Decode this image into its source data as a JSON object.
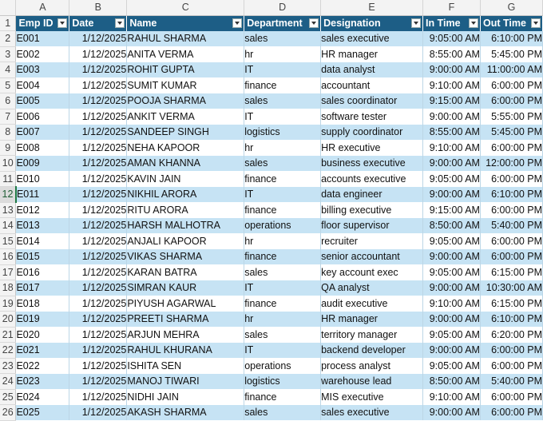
{
  "columns": [
    "A",
    "B",
    "C",
    "D",
    "E",
    "F",
    "G"
  ],
  "headers": [
    "Emp ID",
    "Date",
    "Name",
    "Department",
    "Designation",
    "In Time",
    "Out Time"
  ],
  "rows": [
    {
      "n": "2",
      "c": [
        "E001",
        "1/12/2025",
        "RAHUL SHARMA",
        "sales",
        "sales executive",
        "9:05:00 AM",
        "6:10:00 PM"
      ]
    },
    {
      "n": "3",
      "c": [
        "E002",
        "1/12/2025",
        "ANITA VERMA",
        "hr",
        "HR manager",
        "8:55:00 AM",
        "5:45:00 PM"
      ]
    },
    {
      "n": "4",
      "c": [
        "E003",
        "1/12/2025",
        "ROHIT GUPTA",
        "IT",
        "data analyst",
        "9:00:00 AM",
        "11:00:00 AM"
      ]
    },
    {
      "n": "5",
      "c": [
        "E004",
        "1/12/2025",
        "SUMIT KUMAR",
        "finance",
        "accountant",
        "9:10:00 AM",
        "6:00:00 PM"
      ]
    },
    {
      "n": "6",
      "c": [
        "E005",
        "1/12/2025",
        "POOJA SHARMA",
        "sales",
        "sales coordinator",
        "9:15:00 AM",
        "6:00:00 PM"
      ]
    },
    {
      "n": "7",
      "c": [
        "E006",
        "1/12/2025",
        "ANKIT VERMA",
        "IT",
        "software tester",
        "9:00:00 AM",
        "5:55:00 PM"
      ]
    },
    {
      "n": "8",
      "c": [
        "E007",
        "1/12/2025",
        "SANDEEP SINGH",
        "logistics",
        "supply coordinator",
        "8:55:00 AM",
        "5:45:00 PM"
      ]
    },
    {
      "n": "9",
      "c": [
        "E008",
        "1/12/2025",
        "NEHA KAPOOR",
        "hr",
        "HR executive",
        "9:10:00 AM",
        "6:00:00 PM"
      ]
    },
    {
      "n": "10",
      "c": [
        "E009",
        "1/12/2025",
        "AMAN KHANNA",
        "sales",
        "business executive",
        "9:00:00 AM",
        "12:00:00 PM"
      ]
    },
    {
      "n": "11",
      "c": [
        "E010",
        "1/12/2025",
        "KAVIN JAIN",
        "finance",
        "accounts executive",
        "9:05:00 AM",
        "6:00:00 PM"
      ]
    },
    {
      "n": "12",
      "c": [
        "E011",
        "1/12/2025",
        "NIKHIL ARORA",
        "IT",
        "data engineer",
        "9:00:00 AM",
        "6:10:00 PM"
      ]
    },
    {
      "n": "13",
      "c": [
        "E012",
        "1/12/2025",
        "RITU ARORA",
        "finance",
        "billing executive",
        "9:15:00 AM",
        "6:00:00 PM"
      ]
    },
    {
      "n": "14",
      "c": [
        "E013",
        "1/12/2025",
        "HARSH MALHOTRA",
        "operations",
        "floor supervisor",
        "8:50:00 AM",
        "5:40:00 PM"
      ]
    },
    {
      "n": "15",
      "c": [
        "E014",
        "1/12/2025",
        "ANJALI KAPOOR",
        "hr",
        "recruiter",
        "9:05:00 AM",
        "6:00:00 PM"
      ]
    },
    {
      "n": "16",
      "c": [
        "E015",
        "1/12/2025",
        "VIKAS SHARMA",
        "finance",
        "senior accountant",
        "9:00:00 AM",
        "6:00:00 PM"
      ]
    },
    {
      "n": "17",
      "c": [
        "E016",
        "1/12/2025",
        "KARAN BATRA",
        "sales",
        "key account exec",
        "9:05:00 AM",
        "6:15:00 PM"
      ]
    },
    {
      "n": "18",
      "c": [
        "E017",
        "1/12/2025",
        "SIMRAN KAUR",
        "IT",
        "QA analyst",
        "9:00:00 AM",
        "10:30:00 AM"
      ]
    },
    {
      "n": "19",
      "c": [
        "E018",
        "1/12/2025",
        "PIYUSH AGARWAL",
        "finance",
        "audit executive",
        "9:10:00 AM",
        "6:15:00 PM"
      ]
    },
    {
      "n": "20",
      "c": [
        "E019",
        "1/12/2025",
        "PREETI SHARMA",
        "hr",
        "HR manager",
        "9:00:00 AM",
        "6:10:00 PM"
      ]
    },
    {
      "n": "21",
      "c": [
        "E020",
        "1/12/2025",
        "ARJUN MEHRA",
        "sales",
        "territory manager",
        "9:05:00 AM",
        "6:20:00 PM"
      ]
    },
    {
      "n": "22",
      "c": [
        "E021",
        "1/12/2025",
        "RAHUL KHURANA",
        "IT",
        "backend developer",
        "9:00:00 AM",
        "6:00:00 PM"
      ]
    },
    {
      "n": "23",
      "c": [
        "E022",
        "1/12/2025",
        "ISHITA SEN",
        "operations",
        "process analyst",
        "9:05:00 AM",
        "6:00:00 PM"
      ]
    },
    {
      "n": "24",
      "c": [
        "E023",
        "1/12/2025",
        "MANOJ TIWARI",
        "logistics",
        "warehouse lead",
        "8:50:00 AM",
        "5:40:00 PM"
      ]
    },
    {
      "n": "25",
      "c": [
        "E024",
        "1/12/2025",
        "NIDHI JAIN",
        "finance",
        "MIS executive",
        "9:10:00 AM",
        "6:00:00 PM"
      ]
    },
    {
      "n": "26",
      "c": [
        "E025",
        "1/12/2025",
        "AKASH SHARMA",
        "sales",
        "sales executive",
        "9:00:00 AM",
        "6:00:00 PM"
      ]
    }
  ],
  "selected_row": "12",
  "colors": {
    "header_bg": "#1d5e86",
    "band": "#c6e3f4",
    "selection": "#1f7a43"
  }
}
